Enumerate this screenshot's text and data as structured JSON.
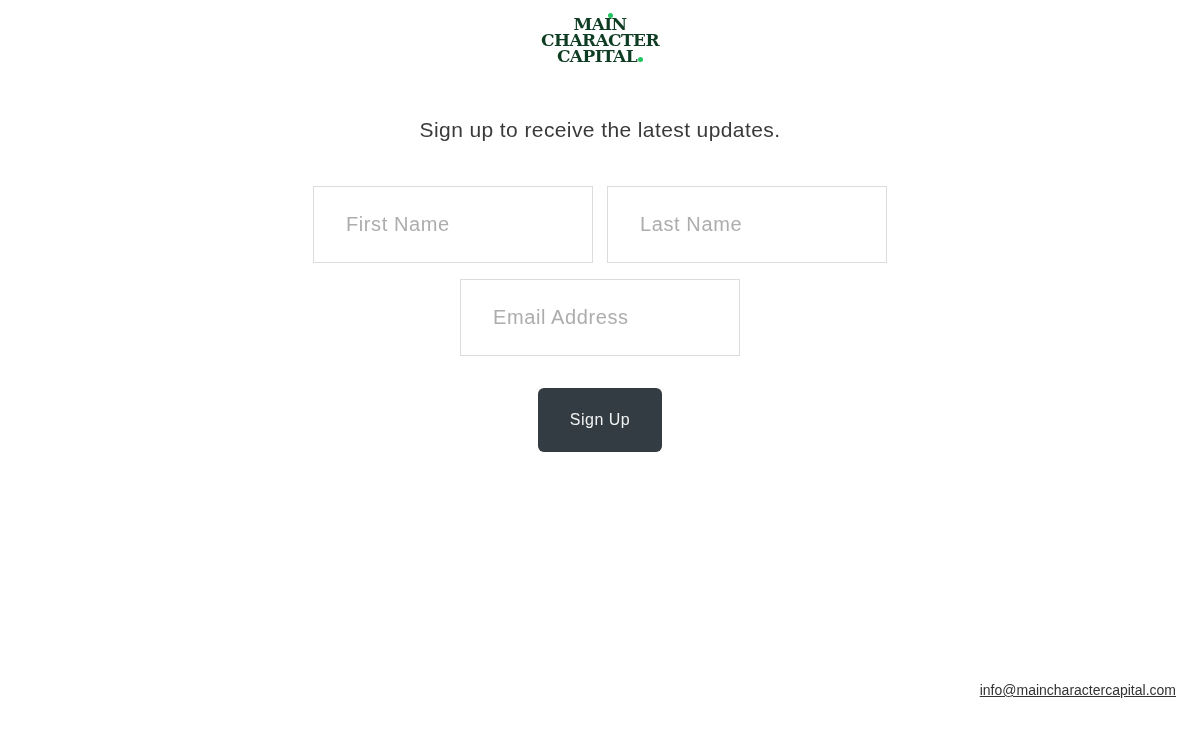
{
  "logo": {
    "lines": [
      "MAIN",
      "CHARACTER",
      "CAPITAL"
    ]
  },
  "heading": "Sign up to receive the latest updates.",
  "form": {
    "rows": [
      {
        "fields": [
          {
            "placeholder": "First Name"
          },
          {
            "placeholder": "Last Name"
          }
        ]
      },
      {
        "fields": [
          {
            "placeholder": "Email Address"
          }
        ]
      }
    ],
    "button": {
      "label": "Sign Up"
    }
  },
  "footer": {
    "email_link": "info@maincharactercapital.com"
  }
}
